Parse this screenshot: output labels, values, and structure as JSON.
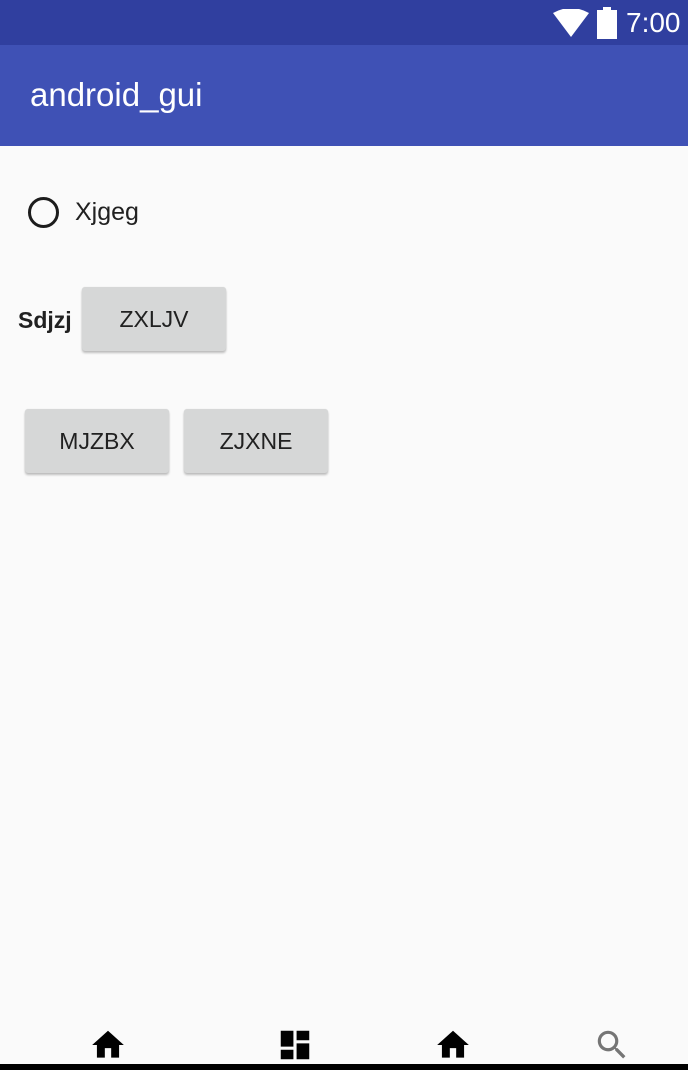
{
  "status_bar": {
    "time": "7:00",
    "icons": [
      "wifi-icon",
      "battery-icon"
    ]
  },
  "app_bar": {
    "title": "android_gui"
  },
  "content": {
    "radio": {
      "label": "Xjgeg",
      "checked": false
    },
    "static_label": "Sdjzj",
    "buttons": [
      {
        "label": "ZXLJV"
      },
      {
        "label": "MJZBX"
      },
      {
        "label": "ZJXNE"
      }
    ]
  },
  "bottom_nav": {
    "icons": [
      "home-icon",
      "dashboard-icon",
      "home-icon",
      "search-icon"
    ]
  },
  "colors": {
    "status_bar": "#303f9f",
    "app_bar": "#3f51b5",
    "background": "#fafafa",
    "button": "#d6d7d7"
  }
}
